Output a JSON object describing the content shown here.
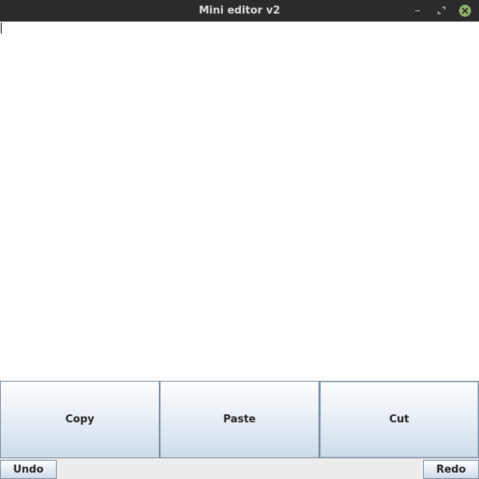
{
  "window": {
    "title": "Mini editor v2",
    "controls": {
      "minimize_icon": "minimize-icon",
      "maximize_icon": "maximize-icon",
      "close_icon": "close-icon",
      "close_color": "#8fb36b"
    }
  },
  "editor": {
    "value": ""
  },
  "actions": {
    "copy_label": "Copy",
    "paste_label": "Paste",
    "cut_label": "Cut"
  },
  "history": {
    "undo_label": "Undo",
    "redo_label": "Redo"
  },
  "colors": {
    "titlebar": "#2b2b2b",
    "button_gradient_top": "#fdfeff",
    "button_gradient_bottom": "#cddceb",
    "button_border": "#7a8a99"
  }
}
